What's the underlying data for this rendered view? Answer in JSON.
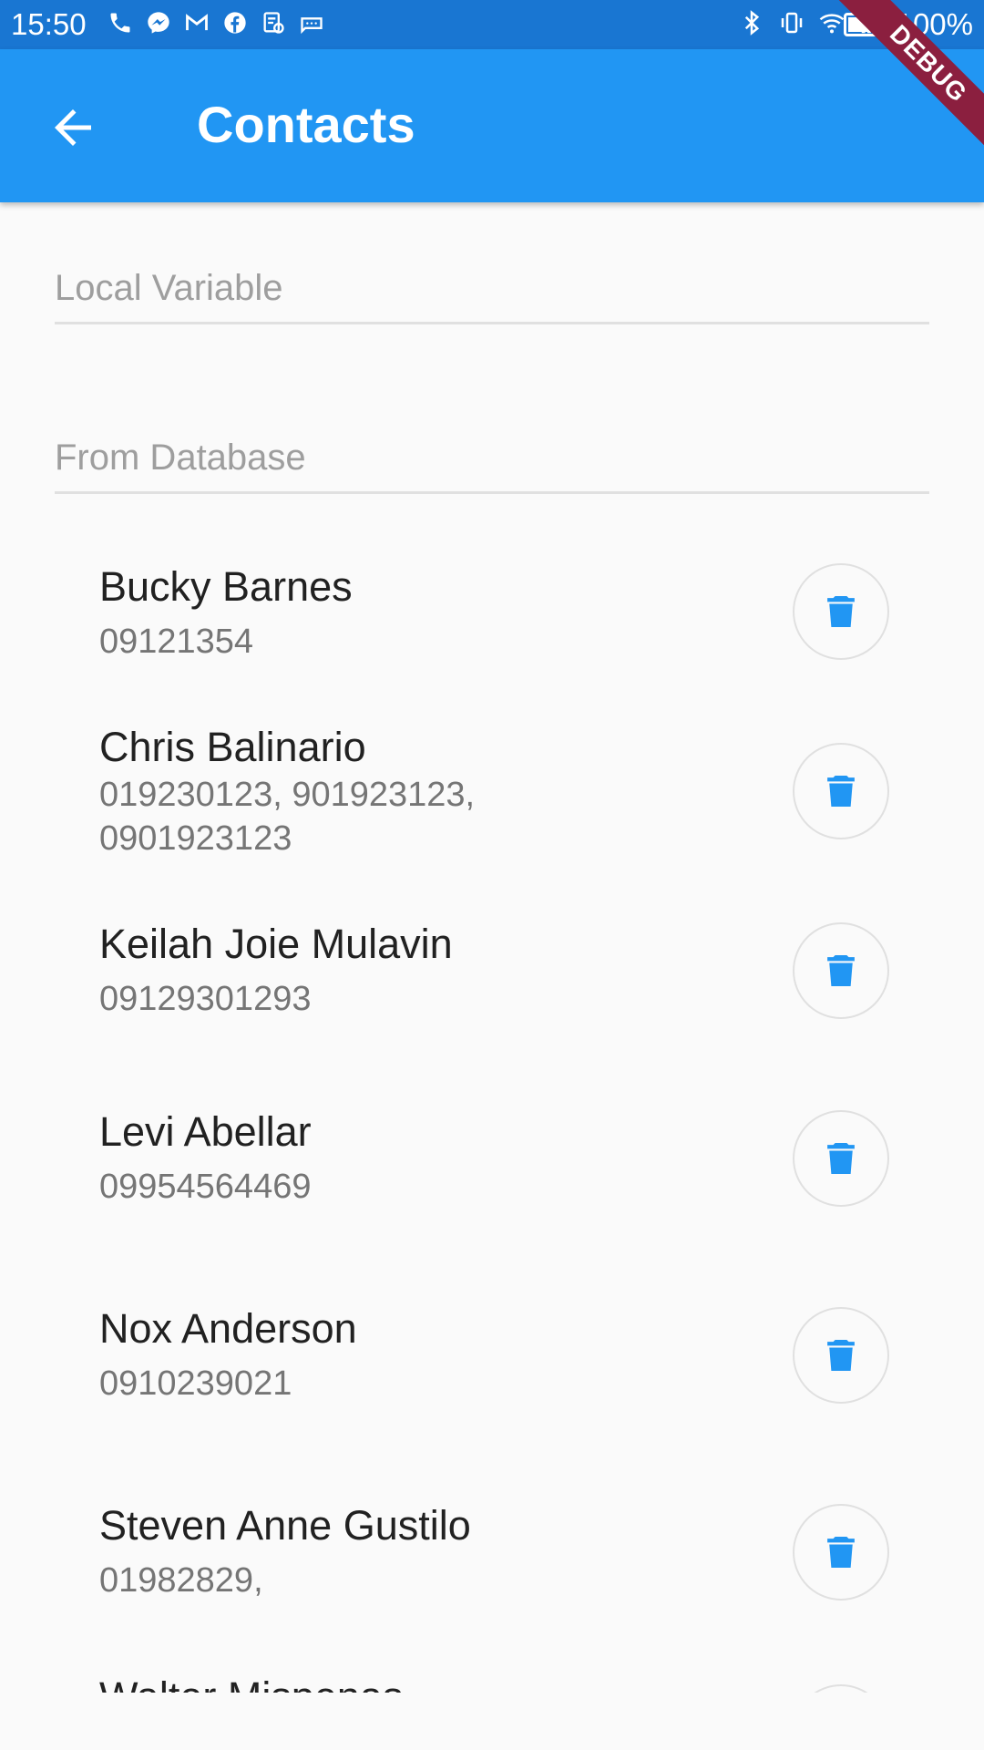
{
  "status_bar": {
    "time": "15:50",
    "battery": "100%",
    "left_icons": [
      "phone-call-icon",
      "messenger-icon",
      "gmail-icon",
      "facebook-icon",
      "notes-icon",
      "message-icon"
    ],
    "right_icons": [
      "bluetooth-icon",
      "vibrate-icon",
      "wifi-icon",
      "signal-icon"
    ]
  },
  "app_bar": {
    "title": "Contacts",
    "back_icon": "arrow-back-icon",
    "background": "#2196f3"
  },
  "debug_banner": "DEBUG",
  "fields": {
    "local_variable": {
      "placeholder": "Local Variable",
      "value": ""
    },
    "from_database": {
      "placeholder": "From Database",
      "value": ""
    }
  },
  "contacts": [
    {
      "name": "Bucky Barnes",
      "phone": "09121354"
    },
    {
      "name": "Chris Balinario",
      "phone": "019230123, 901923123, 0901923123"
    },
    {
      "name": "Keilah Joie Mulavin",
      "phone": "09129301293"
    },
    {
      "name": "Levi Abellar",
      "phone": "09954564469"
    },
    {
      "name": "Nox Anderson",
      "phone": "0910239021"
    },
    {
      "name": "Steven Anne Gustilo",
      "phone": "01982829,"
    },
    {
      "name": "Walter Mispenas",
      "phone": ""
    }
  ],
  "colors": {
    "accent": "#2196f3",
    "status_bar": "#1976d2",
    "debug_ribbon": "#8b1f3f"
  }
}
